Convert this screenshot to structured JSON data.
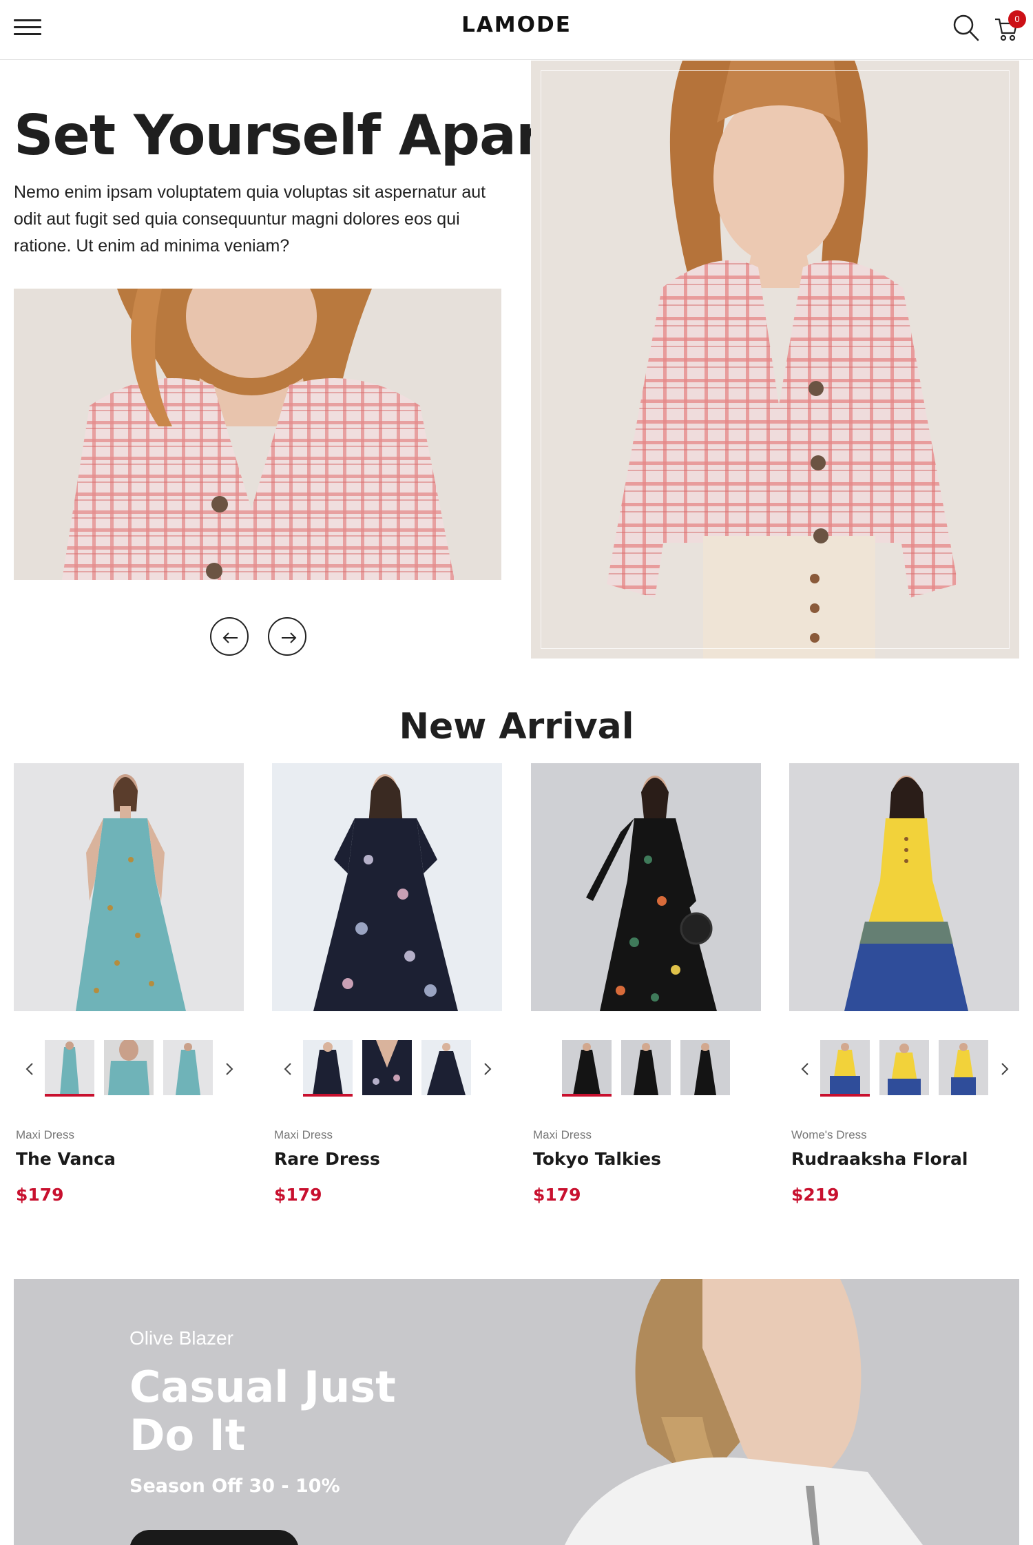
{
  "header": {
    "logo": "LAMODE",
    "cart_count": "0",
    "icons": [
      "hamburger-menu-icon",
      "search-icon",
      "cart-icon"
    ]
  },
  "hero": {
    "title": "Set Yourself Apart",
    "text": "Nemo enim ipsam voluptatem quia voluptas sit aspernatur aut odit aut fugit sed quia consequuntur magni dolores eos qui ratione. Ut enim ad minima veniam?"
  },
  "new_arrival": {
    "title": "New Arrival",
    "products": [
      {
        "category": "Maxi Dress",
        "name": "The Vanca",
        "price": "$179"
      },
      {
        "category": "Maxi Dress",
        "name": "Rare Dress",
        "price": "$179"
      },
      {
        "category": "Maxi Dress",
        "name": "Tokyo Talkies",
        "price": "$179"
      },
      {
        "category": "Wome's Dress",
        "name": "Rudraaksha Floral",
        "price": "$219"
      }
    ]
  },
  "banner": {
    "subtitle": "Olive Blazer",
    "title": "Casual Just Do It",
    "offer": "Season Off 30 - 10%"
  },
  "colors": {
    "accent": "#c8102e",
    "badge": "#cc1016",
    "text": "#1f1f1f"
  }
}
